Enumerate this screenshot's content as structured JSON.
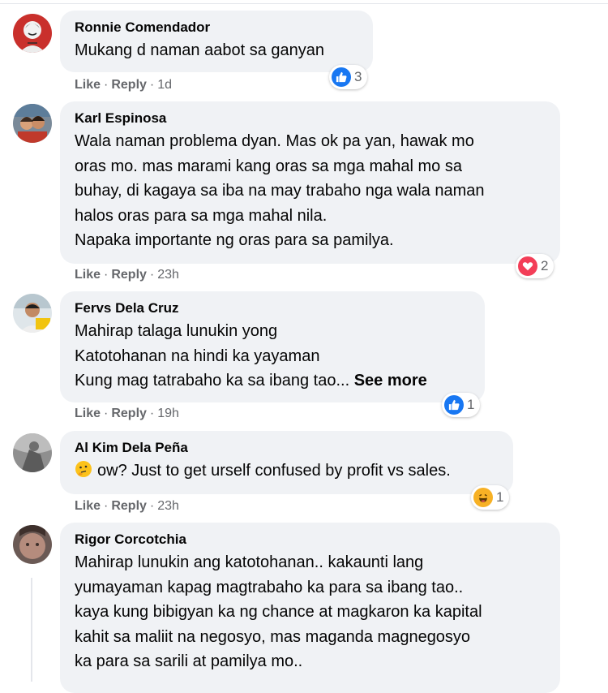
{
  "comments": [
    {
      "author": "Ronnie Comendador",
      "lines": [
        "Mukang d naman aabot sa ganyan"
      ],
      "actions": {
        "like": "Like",
        "reply": "Reply",
        "time": "1d"
      },
      "reaction": {
        "type": "like",
        "count": "3",
        "icon": "like-icon",
        "color": "#1877f2"
      }
    },
    {
      "author": "Karl Espinosa",
      "lines": [
        "Wala naman problema dyan. Mas ok pa yan, hawak mo",
        "oras mo. mas marami kang oras sa mga mahal mo sa",
        "buhay, di kagaya sa iba na may trabaho nga wala naman",
        "halos oras para sa mga mahal nila.",
        "Napaka importante ng oras para sa pamilya."
      ],
      "actions": {
        "like": "Like",
        "reply": "Reply",
        "time": "23h"
      },
      "reaction": {
        "type": "love",
        "count": "2",
        "icon": "heart-icon",
        "color": "#f33e58"
      }
    },
    {
      "author": "Fervs Dela Cruz",
      "lines": [
        "Mahirap talaga lunukin yong",
        "Katotohanan na hindi ka yayaman",
        "Kung mag tatrabaho ka sa ibang tao..."
      ],
      "see_more": "See more",
      "actions": {
        "like": "Like",
        "reply": "Reply",
        "time": "19h"
      },
      "reaction": {
        "type": "like",
        "count": "1",
        "icon": "like-icon",
        "color": "#1877f2"
      }
    },
    {
      "author": "Al Kim Dela Peña",
      "lines": [
        "ow? Just to get urself confused by profit vs sales."
      ],
      "emoji": "thinking-face-emoji",
      "actions": {
        "like": "Like",
        "reply": "Reply",
        "time": "23h"
      },
      "reaction": {
        "type": "haha",
        "count": "1",
        "icon": "haha-icon",
        "color": "#f7b125"
      }
    },
    {
      "author": "Rigor Corcotchia",
      "lines": [
        "Mahirap lunukin ang katotohanan.. kakaunti lang",
        "yumayaman kapag magtrabaho ka para sa ibang tao..",
        "kaya kung bibigyan ka ng chance at magkaron ka kapital",
        "kahit sa maliit na negosyo, mas maganda magnegosyo",
        "ka para sa sarili at pamilya mo.."
      ]
    }
  ]
}
